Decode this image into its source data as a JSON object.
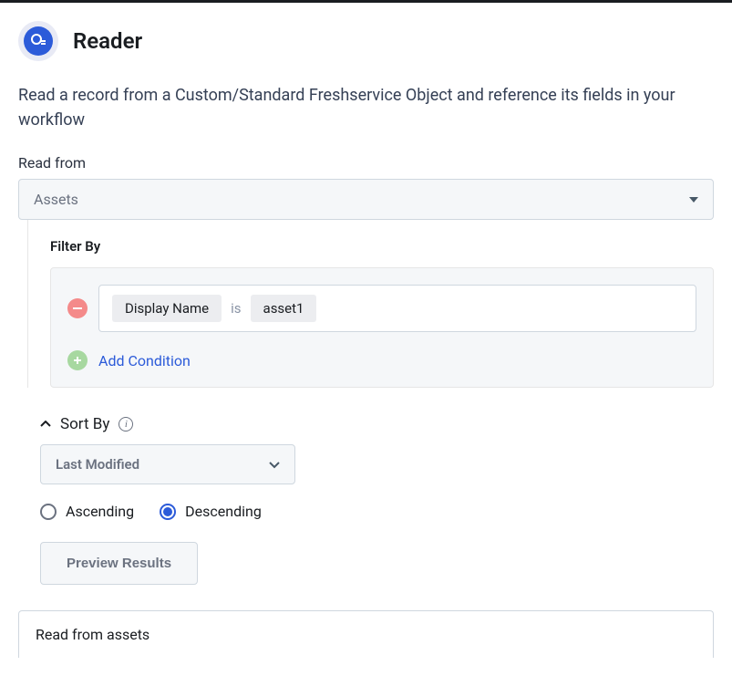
{
  "header": {
    "title": "Reader"
  },
  "description": "Read a record from a Custom/Standard Freshservice Object and reference its fields in your workflow",
  "readFrom": {
    "label": "Read from",
    "value": "Assets"
  },
  "filterBy": {
    "label": "Filter By",
    "conditions": [
      {
        "field": "Display Name",
        "operator": "is",
        "value": "asset1"
      }
    ],
    "addConditionLabel": "Add Condition"
  },
  "sortBy": {
    "label": "Sort By",
    "value": "Last Modified",
    "order": {
      "ascending": "Ascending",
      "descending": "Descending",
      "selected": "descending"
    }
  },
  "previewButton": "Preview Results",
  "bottomPanel": {
    "title": "Read from assets"
  }
}
